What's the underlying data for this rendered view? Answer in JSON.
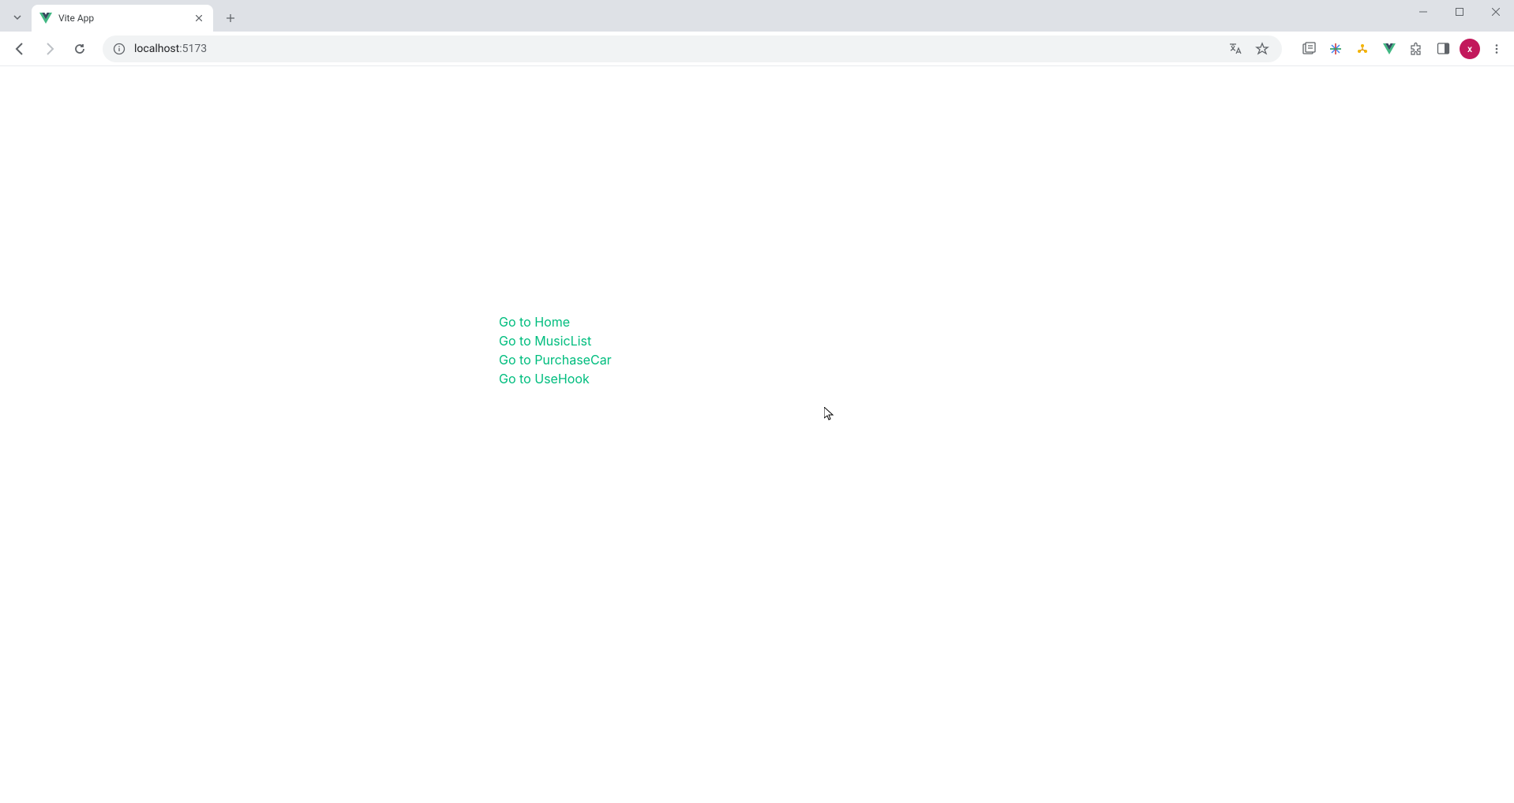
{
  "browser": {
    "tab": {
      "title": "Vite App"
    },
    "url": {
      "host": "localhost",
      "port": ":5173"
    },
    "profile_initial": "x"
  },
  "page": {
    "links": [
      "Go to Home",
      "Go to MusicList",
      "Go to PurchaseCar",
      "Go to UseHook"
    ]
  }
}
